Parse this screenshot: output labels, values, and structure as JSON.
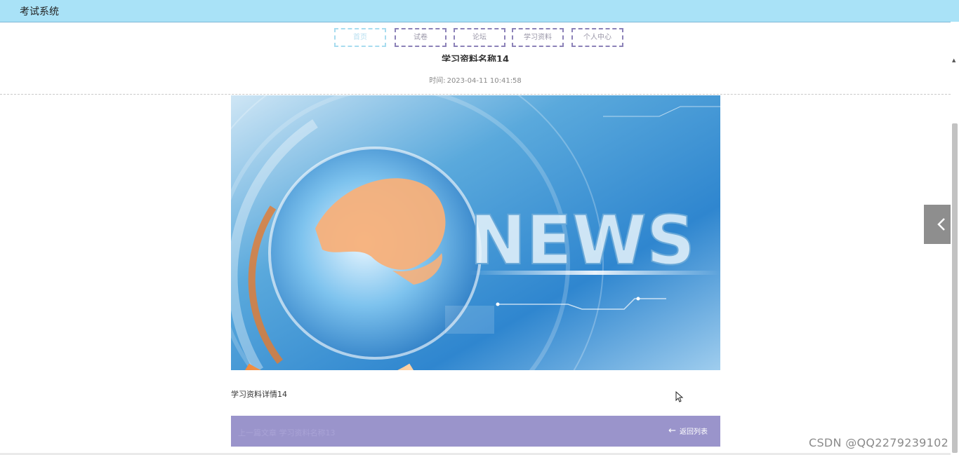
{
  "app": {
    "title": "考试系统"
  },
  "nav": {
    "items": [
      "首页",
      "试卷",
      "论坛",
      "学习资料",
      "个人中心"
    ],
    "active": "首页"
  },
  "article": {
    "title": "学习资料名称14",
    "time_label": "时间:",
    "time_value": "2023-04-11 10:41:58",
    "image_text": "NEWS",
    "detail": "学习资料详情14"
  },
  "footer": {
    "prev_label": "上一篇文章",
    "prev_title": "学习资料名称13",
    "back_label": "返回列表"
  },
  "watermark": "CSDN @QQ2279239102",
  "colors": {
    "header": "#a9e2f7",
    "nav_border": "#8c82b8",
    "footer_bar": "#9a94cb",
    "side_toggle": "#8e8e8e"
  },
  "icons": {
    "side_toggle": "chevron-left-icon",
    "back": "arrow-left-icon",
    "scroll_up": "caret-up-icon",
    "cursor": "mouse-pointer-icon"
  }
}
